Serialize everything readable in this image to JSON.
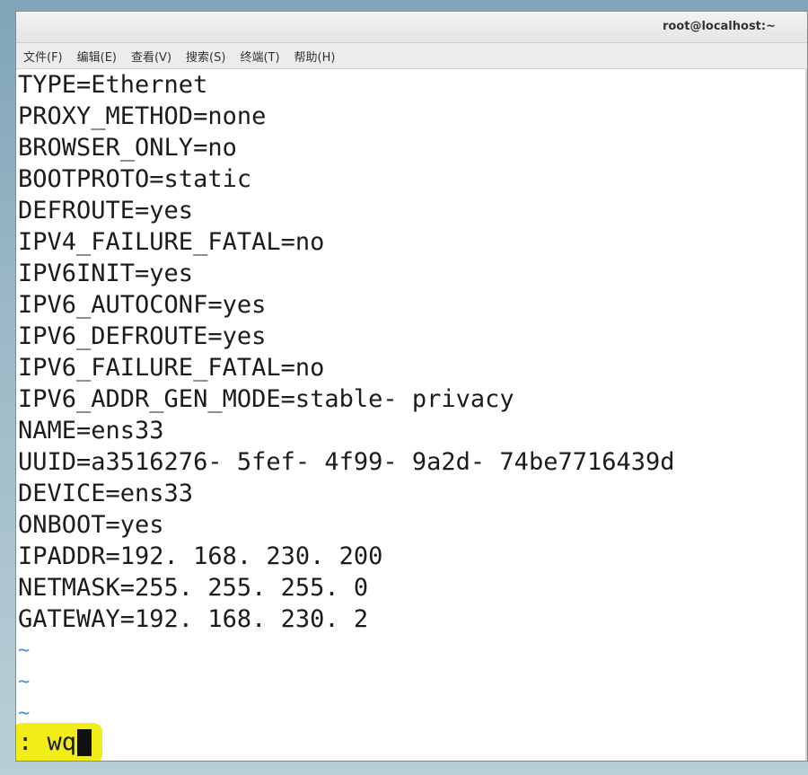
{
  "window": {
    "title": "root@localhost:~"
  },
  "menu": {
    "items": [
      "文件(F)",
      "编辑(E)",
      "查看(V)",
      "搜索(S)",
      "终端(T)",
      "帮助(H)"
    ]
  },
  "terminal": {
    "lines": [
      "TYPE=Ethernet",
      "PROXY_METHOD=none",
      "BROWSER_ONLY=no",
      "BOOTPROTO=static",
      "DEFROUTE=yes",
      "IPV4_FAILURE_FATAL=no",
      "IPV6INIT=yes",
      "IPV6_AUTOCONF=yes",
      "IPV6_DEFROUTE=yes",
      "IPV6_FAILURE_FATAL=no",
      "IPV6_ADDR_GEN_MODE=stable- privacy",
      "NAME=ens33",
      "UUID=a3516276- 5fef- 4f99- 9a2d- 74be7716439d",
      "DEVICE=ens33",
      "ONBOOT=yes",
      "IPADDR=192. 168. 230. 200",
      "NETMASK=255. 255. 255. 0",
      "GATEWAY=192. 168. 230. 2"
    ],
    "tildes": [
      "~",
      "~",
      "~"
    ],
    "command": ": wq",
    "highlight_color": "#f2ec17",
    "tilde_color": "#4a8fd0"
  }
}
